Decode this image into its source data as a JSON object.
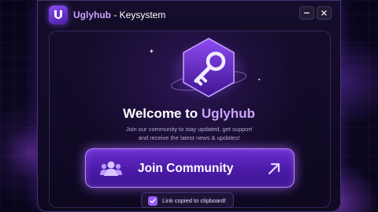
{
  "window": {
    "app_name": "Uglyhub",
    "separator": " - ",
    "app_subtitle": "Keysystem",
    "minimize_icon": "minimize-icon",
    "close_icon": "close-icon"
  },
  "hero": {
    "icon": "key-icon",
    "heading_prefix": "Welcome to ",
    "heading_accent": "Uglyhub",
    "description_line1": "Join our community to stay updated, get support",
    "description_line2": "and receive the latest news & updates!"
  },
  "join_button": {
    "label": "Join Community",
    "left_icon": "users-icon",
    "right_icon": "arrow-up-right-icon"
  },
  "toast": {
    "message": "Link copied to clipboard!",
    "icon": "check-icon"
  },
  "colors": {
    "accent": "#c9a4ff",
    "button": "#5a23bf",
    "background": "#0c0820"
  }
}
